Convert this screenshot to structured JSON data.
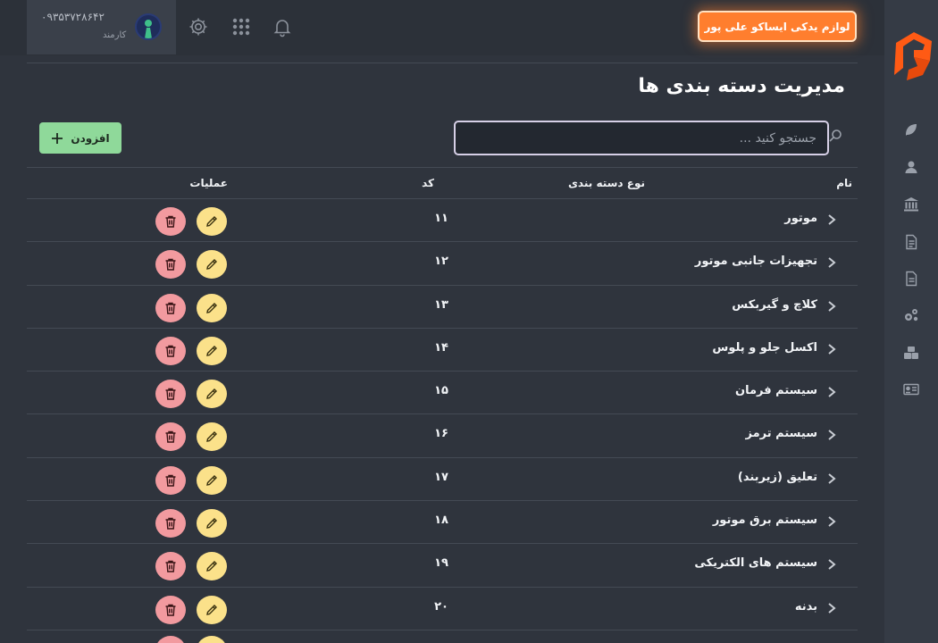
{
  "header": {
    "user_phone": "۰۹۳۵۳۷۲۸۶۴۲",
    "user_role": "کارمند",
    "store_name": "لوازم یدکی ایساکو علی پور",
    "icons": [
      "settings-icon",
      "apps-grid-icon",
      "bell-icon"
    ]
  },
  "sidebar": {
    "icons": [
      "leaf-icon",
      "user-icon",
      "bank-icon",
      "document-icon",
      "document-2-icon",
      "gears-icon",
      "boxes-icon",
      "id-card-icon"
    ]
  },
  "page": {
    "title": "مدیریت دسته بندی ها",
    "search_placeholder": "جستجو کنید ...",
    "add_label": "افزودن"
  },
  "table": {
    "headers": {
      "name": "نام",
      "type": "نوع دسته بندی",
      "code": "کد",
      "ops": "عملیات"
    },
    "rows": [
      {
        "name": "موتور",
        "code": "۱۱"
      },
      {
        "name": "تجهیزات جانبی موتور",
        "code": "۱۲"
      },
      {
        "name": "کلاچ و گیربکس",
        "code": "۱۳"
      },
      {
        "name": "اکسل جلو و پلوس",
        "code": "۱۴"
      },
      {
        "name": "سیستم فرمان",
        "code": "۱۵"
      },
      {
        "name": "سیستم ترمز",
        "code": "۱۶"
      },
      {
        "name": "تعلیق (زیربند)",
        "code": "۱۷"
      },
      {
        "name": "سیستم برق موتور",
        "code": "۱۸"
      },
      {
        "name": "سیستم های الکتریکی",
        "code": "۱۹"
      },
      {
        "name": "بدنه",
        "code": "۲۰"
      }
    ]
  },
  "colors": {
    "accent_orange": "#ff7e2e",
    "add_green": "#8fd99a",
    "edit_yellow": "#fbe18a",
    "delete_red": "#f29a9f"
  }
}
